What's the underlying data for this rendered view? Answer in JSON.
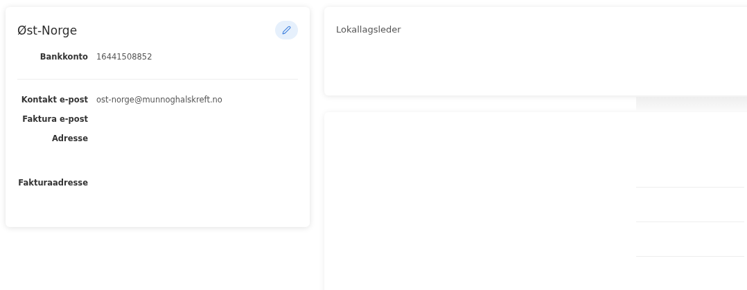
{
  "organization_card": {
    "title": "Øst-Norge",
    "fields": [
      {
        "label": "Bankkonto",
        "value": "16441508852",
        "kind": "text"
      }
    ],
    "contact_fields": [
      {
        "label": "Kontakt e-post",
        "value": "ost-norge@munnoghalskreft.no",
        "kind": "text"
      },
      {
        "label": "Faktura e-post",
        "kind": "text"
      },
      {
        "label": "Adresse",
        "kind": "address"
      },
      {
        "label": "Fakturaadresse",
        "kind": "address"
      }
    ]
  },
  "leader_card": {
    "title": "Lokallagsleder"
  }
}
